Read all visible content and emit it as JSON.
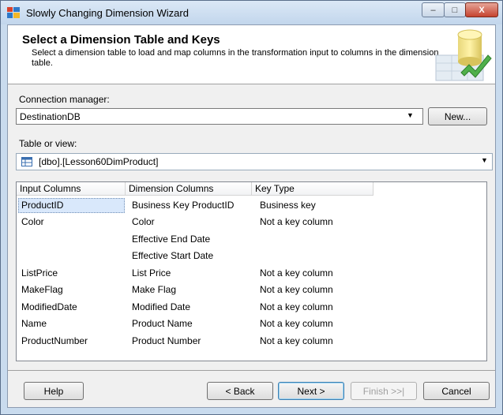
{
  "window": {
    "title": "Slowly Changing Dimension Wizard",
    "minimize_glyph": "–",
    "maximize_glyph": "□",
    "close_glyph": "X"
  },
  "header": {
    "title": "Select a Dimension Table and Keys",
    "description": "Select a dimension table to load and map columns in the transformation input to columns in the dimension table."
  },
  "connection": {
    "label": "Connection manager:",
    "value": "DestinationDB",
    "new_button": "New..."
  },
  "table": {
    "label": "Table or view:",
    "value": "[dbo].[Lesson60DimProduct]"
  },
  "grid": {
    "columns": [
      "Input Columns",
      "Dimension Columns",
      "Key Type"
    ],
    "rows": [
      [
        "ProductID",
        "Business Key ProductID",
        "Business key"
      ],
      [
        "Color",
        "Color",
        "Not a key column"
      ],
      [
        "",
        "Effective End Date",
        ""
      ],
      [
        "",
        "Effective Start Date",
        ""
      ],
      [
        "ListPrice",
        "List Price",
        "Not a key column"
      ],
      [
        "MakeFlag",
        "Make Flag",
        "Not a key column"
      ],
      [
        "ModifiedDate",
        "Modified Date",
        "Not a key column"
      ],
      [
        "Name",
        "Product Name",
        "Not a key column"
      ],
      [
        "ProductNumber",
        "Product Number",
        "Not a key column"
      ]
    ]
  },
  "footer": {
    "help": "Help",
    "back": "< Back",
    "next": "Next >",
    "finish": "Finish >>|",
    "cancel": "Cancel"
  },
  "icons": {
    "app": "wizard-app-icon",
    "header": "dimension-table-icon",
    "table": "table-icon"
  }
}
